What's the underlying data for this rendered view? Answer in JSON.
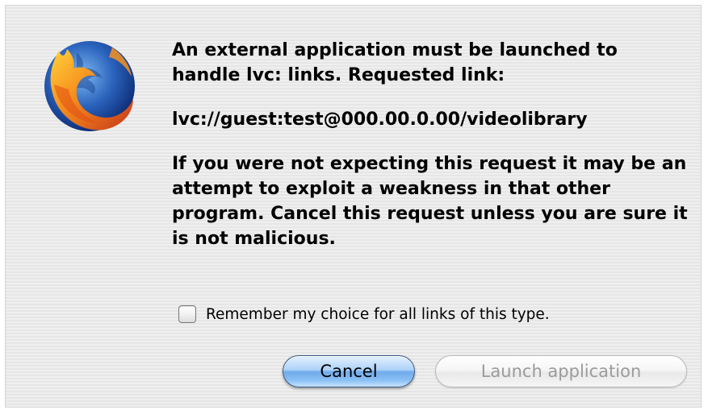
{
  "dialog": {
    "icon": "firefox-logo-icon",
    "message_intro": "An external application must be launched to handle lvc: links. Requested link:",
    "requested_link": "lvc://guest:test@000.00.0.00/videolibrary",
    "warning": "If you were not expecting this request it may be an attempt to exploit a weakness in that other program. Cancel this request unless you are sure it is not malicious.",
    "remember_checkbox": {
      "label": "Remember my choice for all links of this type.",
      "checked": false
    },
    "buttons": {
      "cancel_label": "Cancel",
      "launch_label": "Launch application"
    }
  },
  "colors": {
    "default_button": "#8cc1f5",
    "disabled_text": "#9b9b9b",
    "dialog_background": "#ececec"
  }
}
